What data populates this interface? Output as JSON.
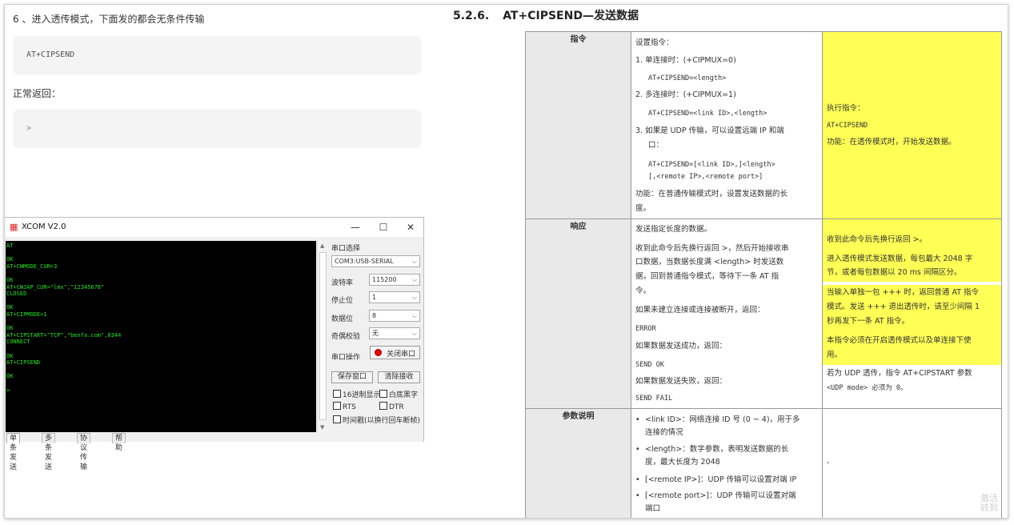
{
  "left_doc": {
    "step_text": "6 、进入透传模式，下面发的都会无条件传输",
    "code1": "AT+CIPSEND",
    "return_text": "正常返回：",
    "code2": ">"
  },
  "xcom": {
    "title": "XCOM V2.0",
    "window_buttons": {
      "minimize": "—",
      "maximize": "☐",
      "close": "✕"
    },
    "console_lines": [
      "AT",
      "",
      "OK",
      "AT+CWMODE_CUR=3",
      "",
      "OK",
      "AT+CWJAP_CUR=\"lmx\",\"12345678\"",
      "CLOSED",
      "",
      "OK",
      "AT+CIPMODE=1",
      "",
      "OK",
      "AT+CIPSTART=\"TCP\",\"benfa.com\",8344",
      "CONNECT",
      "",
      "OK",
      "AT+CIPSEND",
      "",
      "OK",
      "",
      ">"
    ],
    "port_label": "串口选择",
    "port_value": "COM3:USB-SERIAL",
    "baud_label": "波特率",
    "baud_value": "115200",
    "stop_label": "停止位",
    "stop_value": "1",
    "data_label": "数据位",
    "data_value": "8",
    "parity_label": "奇偶校验",
    "parity_value": "无",
    "op_label": "串口操作",
    "close_port": "关闭串口",
    "save_window": "保存窗口",
    "clear_receive": "清除接收",
    "hex_display": "16进制显示",
    "white_black": "白底黑字",
    "rts": "RTS",
    "dtr": "DTR",
    "timestamp": "时间戳(以换行回车断帧)",
    "tabs": [
      "单条发送",
      "多条发送",
      "协议传输",
      "帮助"
    ]
  },
  "right_doc": {
    "section_num": "5.2.6.",
    "section_title": "AT+CIPSEND—发送数据",
    "row1": {
      "head": "指令",
      "mid": [
        "设置指令：",
        "1.  单连接时：(+CIPMUX=0)",
        "AT+CIPSEND=<length>",
        "2.  多连接时：(+CIPMUX=1)",
        "AT+CIPSEND=<link ID>,<length>",
        "3.  如果是 UDP 传输，可以设置远端 IP 和端",
        "口：",
        "AT+CIPSEND=[<link ID>,]<length>",
        "[,<remote IP>,<remote port>]",
        "功能：在普通传输模式时，设置发送数据的长",
        "度。"
      ],
      "right": [
        "执行指令：",
        "AT+CIPSEND",
        "功能：在透传模式时，开始发送数据。"
      ]
    },
    "row2": {
      "head": "响应",
      "mid": [
        "发送指定长度的数据。",
        "收到此命令后先换行返回 >，然后开始接收串",
        "口数据，当数据长度满 <length> 时发送数",
        "据，回到普通指令模式，等待下一条 AT 指",
        "令。",
        "如果未建立连接或连接被断开，返回：",
        "ERROR",
        "如果数据发送成功，返回：",
        "SEND OK",
        "如果数据发送失败，返回：",
        "SEND FAIL"
      ],
      "right": [
        "收到此命令后先换行返回 >。",
        "进入透传模式发送数据，每包最大 2048 字",
        "节，或者每包数据以 20 ms 间隔区分。",
        "当输入单独一包 +++ 时，返回普通 AT 指令",
        "模式。发送 +++ 退出透传时，请至少间隔 1",
        "秒再发下一条 AT 指令。",
        "本指令必须在开启透传模式以及单连接下使",
        "用。",
        "若为 UDP 透传，指令 AT+CIPSTART 参数",
        "<UDP mode> 必须为 0。"
      ]
    },
    "row3": {
      "head": "参数说明",
      "mid": [
        "<link ID>：网络连接 ID 号 (0 ~ 4)，用于多",
        "连接的情况",
        "<length>：数字参数，表明发送数据的长",
        "度，最大长度为 2048",
        "[<remote IP>]：UDP 传输可以设置对端 IP",
        "[<remote port>]：UDP 传输可以设置对端",
        "端口"
      ],
      "right": [
        "-"
      ]
    }
  },
  "watermark": [
    "激活",
    "转到"
  ],
  "colors": {
    "highlight": "#ffff55",
    "console_bg": "#000000",
    "console_text": "#22e622"
  }
}
